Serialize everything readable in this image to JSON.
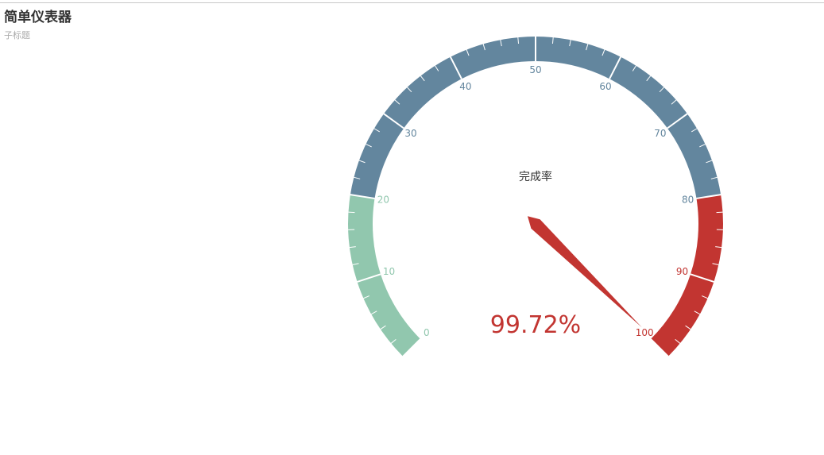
{
  "chart_data": {
    "type": "gauge",
    "title": "简单仪表器",
    "subtitle": "子标题",
    "min": 0,
    "max": 100,
    "tick_labels": [
      "0",
      "10",
      "20",
      "30",
      "40",
      "50",
      "60",
      "70",
      "80",
      "90",
      "100"
    ],
    "bands": [
      {
        "from": 0,
        "to": 20,
        "color": "#91c7ae"
      },
      {
        "from": 20,
        "to": 80,
        "color": "#63869e"
      },
      {
        "from": 80,
        "to": 100,
        "color": "#c23531"
      }
    ],
    "series": [
      {
        "name": "完成率",
        "value": 99.72,
        "value_label": "99.72%"
      }
    ]
  }
}
